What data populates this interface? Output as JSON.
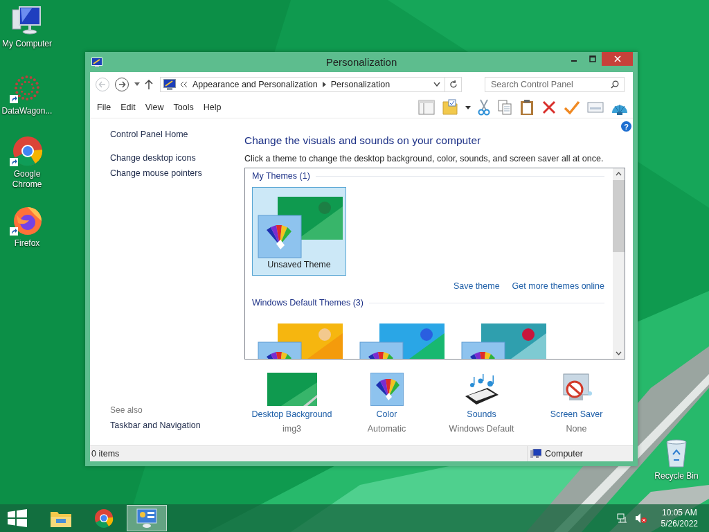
{
  "desktop_icons": [
    {
      "label": "My Computer",
      "kind": "computer",
      "shortcut": false
    },
    {
      "label": "DataWagon...",
      "kind": "datawagon",
      "shortcut": true
    },
    {
      "label": "Google Chrome",
      "kind": "chrome",
      "shortcut": true
    },
    {
      "label": "Firefox",
      "kind": "firefox",
      "shortcut": true
    }
  ],
  "recycle_bin": {
    "label": "Recycle Bin"
  },
  "window": {
    "title": "Personalization"
  },
  "address": {
    "crumbs": [
      "Appearance and Personalization",
      "Personalization"
    ]
  },
  "search": {
    "placeholder": "Search Control Panel"
  },
  "menu": [
    "File",
    "Edit",
    "View",
    "Tools",
    "Help"
  ],
  "help_glyph": "?",
  "sidebar": {
    "items": [
      "Control Panel Home",
      "Change desktop icons",
      "Change mouse pointers"
    ],
    "see_also_heading": "See also",
    "see_also": [
      "Taskbar and Navigation"
    ]
  },
  "heading": "Change the visuals and sounds on your computer",
  "intro": "Click a theme to change the desktop background, color, sounds, and screen saver all at once.",
  "theme_groups": [
    {
      "title": "My Themes (1)",
      "themes": [
        {
          "label": "Unsaved Theme",
          "kind": "green",
          "selected": true
        }
      ],
      "links": [
        "Save theme",
        "Get more themes online"
      ]
    },
    {
      "title": "Windows Default Themes (3)",
      "themes": [
        {
          "kind": "yellow",
          "selected": false
        },
        {
          "kind": "blue",
          "selected": false
        },
        {
          "kind": "flower",
          "selected": false
        }
      ]
    }
  ],
  "settings": [
    {
      "kind": "background",
      "label": "Desktop Background",
      "value": "img3"
    },
    {
      "kind": "color",
      "label": "Color",
      "value": "Automatic"
    },
    {
      "kind": "sounds",
      "label": "Sounds",
      "value": "Windows Default"
    },
    {
      "kind": "screensaver",
      "label": "Screen Saver",
      "value": "None"
    }
  ],
  "status_bar": {
    "items": "0 items",
    "location": "Computer"
  },
  "taskbar": {
    "apps": [
      {
        "kind": "explorer",
        "selected": false
      },
      {
        "kind": "chrome",
        "selected": false
      },
      {
        "kind": "control_panel",
        "selected": true
      }
    ],
    "time": "10:05 AM",
    "date": "5/26/2022"
  }
}
